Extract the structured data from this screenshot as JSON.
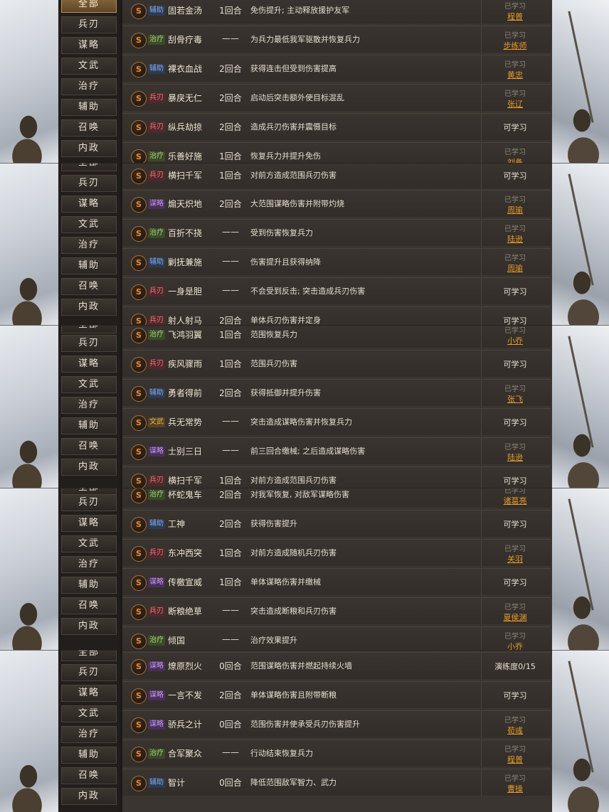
{
  "menu_items": [
    "全部",
    "兵刃",
    "谋略",
    "文武",
    "治疗",
    "辅助",
    "召唤",
    "内政"
  ],
  "badge_letter": "S",
  "learned_label": "已学习",
  "screens": [
    {
      "rows": [
        {
          "tag": "辅助",
          "name": "固若金汤",
          "turns": "1回合",
          "desc": "免伤提升; 主动释放援护友军",
          "status": {
            "type": "learned",
            "by": "程普"
          }
        },
        {
          "tag": "治疗",
          "name": "刮骨疗毒",
          "turns": "——",
          "desc": "为兵力最低我军驱散并恢复兵力",
          "status": {
            "type": "learned",
            "by": "步练师"
          }
        },
        {
          "tag": "辅助",
          "name": "裸衣血战",
          "turns": "2回合",
          "desc": "获得连击但受到伤害提高",
          "status": {
            "type": "learned",
            "by": "黄忠"
          }
        },
        {
          "tag": "兵刃",
          "name": "暴戾无仁",
          "turns": "2回合",
          "desc": "启动后突击额外使目标混乱",
          "status": {
            "type": "learned",
            "by": "张辽"
          }
        },
        {
          "tag": "兵刃",
          "name": "纵兵劫掠",
          "turns": "2回合",
          "desc": "造成兵刃伤害并震慑目标",
          "status": {
            "type": "plain",
            "text": "可学习"
          }
        },
        {
          "tag": "治疗",
          "name": "乐善好施",
          "turns": "1回合",
          "desc": "恢复兵力并提升免伤",
          "status": {
            "type": "learned",
            "by": "刘备"
          }
        }
      ]
    },
    {
      "rows": [
        {
          "tag": "兵刃",
          "name": "横扫千军",
          "turns": "1回合",
          "desc": "对前方造成范围兵刃伤害",
          "status": {
            "type": "plain",
            "text": "可学习"
          }
        },
        {
          "tag": "谋略",
          "name": "煽天炽地",
          "turns": "2回合",
          "desc": "大范围谋略伤害并附带灼烧",
          "status": {
            "type": "learned",
            "by": "周瑜"
          }
        },
        {
          "tag": "治疗",
          "name": "百折不挠",
          "turns": "——",
          "desc": "受到伤害恢复兵力",
          "status": {
            "type": "learned",
            "by": "陆逊"
          }
        },
        {
          "tag": "辅助",
          "name": "剿抚兼施",
          "turns": "——",
          "desc": "伤害提升且获得纳降",
          "status": {
            "type": "learned",
            "by": "周瑜"
          }
        },
        {
          "tag": "兵刃",
          "name": "一身是胆",
          "turns": "——",
          "desc": "不会受到反击; 突击造成兵刃伤害",
          "status": {
            "type": "plain",
            "text": "可学习"
          }
        },
        {
          "tag": "兵刃",
          "name": "射人射马",
          "turns": "2回合",
          "desc": "单体兵刃伤害并定身",
          "status": {
            "type": "plain",
            "text": "可学习"
          }
        }
      ]
    },
    {
      "rows": [
        {
          "tag": "治疗",
          "name": "飞鸿羽翼",
          "turns": "1回合",
          "desc": "范围恢复兵力",
          "status": {
            "type": "learned",
            "by": "小乔"
          }
        },
        {
          "tag": "兵刃",
          "name": "疾风骤雨",
          "turns": "1回合",
          "desc": "范围兵刃伤害",
          "status": {
            "type": "plain",
            "text": "可学习"
          }
        },
        {
          "tag": "辅助",
          "name": "勇者得前",
          "turns": "2回合",
          "desc": "获得抵御并提升伤害",
          "status": {
            "type": "learned",
            "by": "张飞"
          }
        },
        {
          "tag": "文武",
          "name": "兵无常势",
          "turns": "——",
          "desc": "突击造成谋略伤害并恢复兵力",
          "status": {
            "type": "plain",
            "text": "可学习"
          }
        },
        {
          "tag": "谋略",
          "name": "士别三日",
          "turns": "——",
          "desc": "前三回合缴械; 之后造成谋略伤害",
          "status": {
            "type": "learned",
            "by": "陆逊"
          }
        },
        {
          "tag": "兵刃",
          "name": "横扫千军",
          "turns": "1回合",
          "desc": "对前方造成范围兵刃伤害",
          "status": {
            "type": "plain",
            "text": "可学习"
          }
        }
      ]
    },
    {
      "rows": [
        {
          "tag": "治疗",
          "name": "杯蛇鬼车",
          "turns": "2回合",
          "desc": "对我军恢复, 对敌军谋略伤害",
          "status": {
            "type": "learned",
            "by": "诸葛亮"
          }
        },
        {
          "tag": "辅助",
          "name": "工神",
          "turns": "2回合",
          "desc": "获得伤害提升",
          "status": {
            "type": "plain",
            "text": "可学习"
          }
        },
        {
          "tag": "兵刃",
          "name": "东冲西突",
          "turns": "1回合",
          "desc": "对前方造成随机兵刃伤害",
          "status": {
            "type": "learned",
            "by": "关羽"
          }
        },
        {
          "tag": "谋略",
          "name": "传檄宣威",
          "turns": "1回合",
          "desc": "单体谋略伤害并缴械",
          "status": {
            "type": "plain",
            "text": "可学习"
          }
        },
        {
          "tag": "兵刃",
          "name": "断粮绝草",
          "turns": "——",
          "desc": "突击造成断粮和兵刃伤害",
          "status": {
            "type": "learned",
            "by": "夏侯渊"
          }
        },
        {
          "tag": "治疗",
          "name": "倾国",
          "turns": "——",
          "desc": "治疗效果提升",
          "status": {
            "type": "learned",
            "by": "小乔"
          }
        }
      ]
    },
    {
      "rows": [
        {
          "tag": "谋略",
          "name": "燎原烈火",
          "turns": "0回合",
          "desc": "范围谋略伤害并燃起持续火墙",
          "status": {
            "type": "plain",
            "text": "演练度0/15"
          }
        },
        {
          "tag": "谋略",
          "name": "一言不发",
          "turns": "2回合",
          "desc": "单体谋略伤害且附带断粮",
          "status": {
            "type": "plain",
            "text": "可学习"
          }
        },
        {
          "tag": "谋略",
          "name": "骄兵之计",
          "turns": "0回合",
          "desc": "范围伤害并使承受兵刃伤害提升",
          "status": {
            "type": "learned",
            "by": "荀彧"
          }
        },
        {
          "tag": "治疗",
          "name": "合军聚众",
          "turns": "——",
          "desc": "行动结束恢复兵力",
          "status": {
            "type": "learned",
            "by": "程普"
          }
        },
        {
          "tag": "辅助",
          "name": "智计",
          "turns": "0回合",
          "desc": "降低范围敌军智力、武力",
          "status": {
            "type": "learned",
            "by": "曹操"
          }
        }
      ]
    }
  ]
}
